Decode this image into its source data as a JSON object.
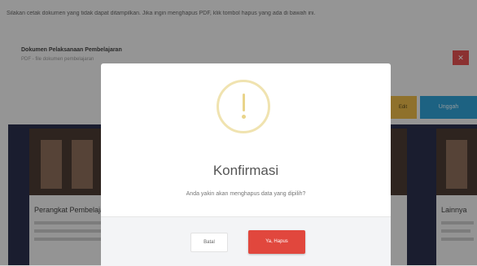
{
  "background": {
    "notice": "Silakan cetak dokumen yang tidak dapat ditampilkan. Jika ingin menghapus PDF, klik tombol hapus yang ada di bawah ini.",
    "document": {
      "title": "Dokumen Pelaksanaan Pembelajaran",
      "subtitle": "PDF - file dokumen pembelajaran"
    },
    "close_button": "✕",
    "yellow_button": "Edit",
    "blue_button": "Unggah",
    "cards": [
      {
        "title": "Perangkat Pembelajaran"
      },
      {
        "title": "Lainnya"
      }
    ]
  },
  "modal": {
    "icon": "warning-icon",
    "title": "Konfirmasi",
    "message": "Anda yakin akan menghapus data yang dipilih?",
    "cancel_label": "Batal",
    "confirm_label": "Ya, Hapus",
    "accent_color": "#e1473d",
    "icon_color": "#e9d48a"
  }
}
